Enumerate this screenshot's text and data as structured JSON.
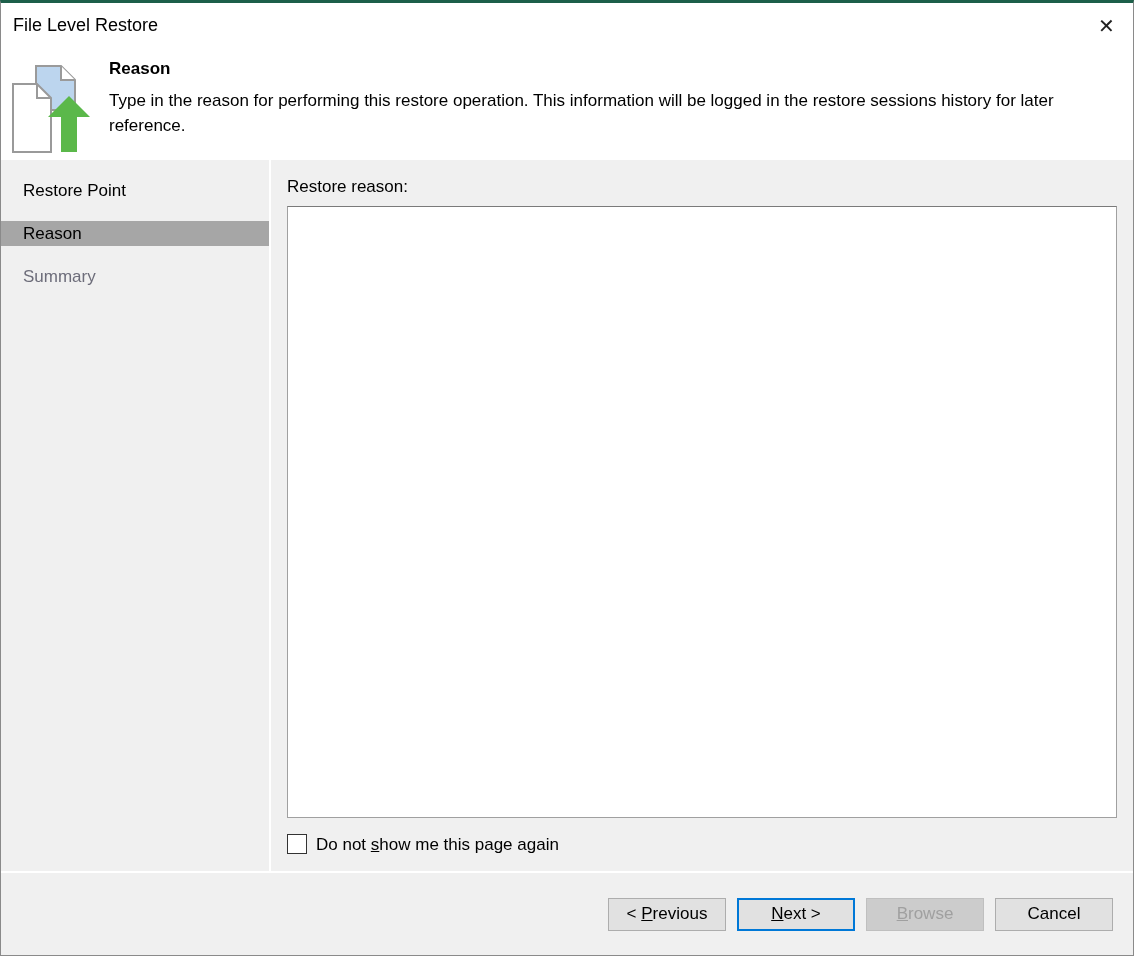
{
  "window": {
    "title": "File Level Restore",
    "close": "✕"
  },
  "header": {
    "title": "Reason",
    "description": "Type in the reason for performing this restore operation. This information will be logged in the restore sessions history for later reference."
  },
  "steps": [
    {
      "label": "Restore Point",
      "selected": false,
      "disabled": false
    },
    {
      "label": "Reason",
      "selected": true,
      "disabled": false
    },
    {
      "label": "Summary",
      "selected": false,
      "disabled": true
    }
  ],
  "reason_field": {
    "label": "Restore reason:"
  },
  "dont_show": {
    "label": [
      {
        "text": "Do not ",
        "underlined": false
      },
      {
        "text": "s",
        "underlined": true
      },
      {
        "text": "how me this page again",
        "underlined": false
      }
    ],
    "checked": false
  },
  "buttons": [
    {
      "label": [
        {
          "text": "< ",
          "underlined": false
        },
        {
          "text": "P",
          "underlined": true
        },
        {
          "text": "revious",
          "underlined": false
        }
      ],
      "default": false,
      "disabled": false
    },
    {
      "label": [
        {
          "text": "N",
          "underlined": true
        },
        {
          "text": "ext >",
          "underlined": false
        }
      ],
      "default": true,
      "disabled": false
    },
    {
      "label": [
        {
          "text": "B",
          "underlined": true
        },
        {
          "text": "rowse",
          "underlined": false
        }
      ],
      "default": false,
      "disabled": true
    },
    {
      "label": [
        {
          "text": "Cancel",
          "underlined": false
        }
      ],
      "default": false,
      "disabled": false
    }
  ]
}
